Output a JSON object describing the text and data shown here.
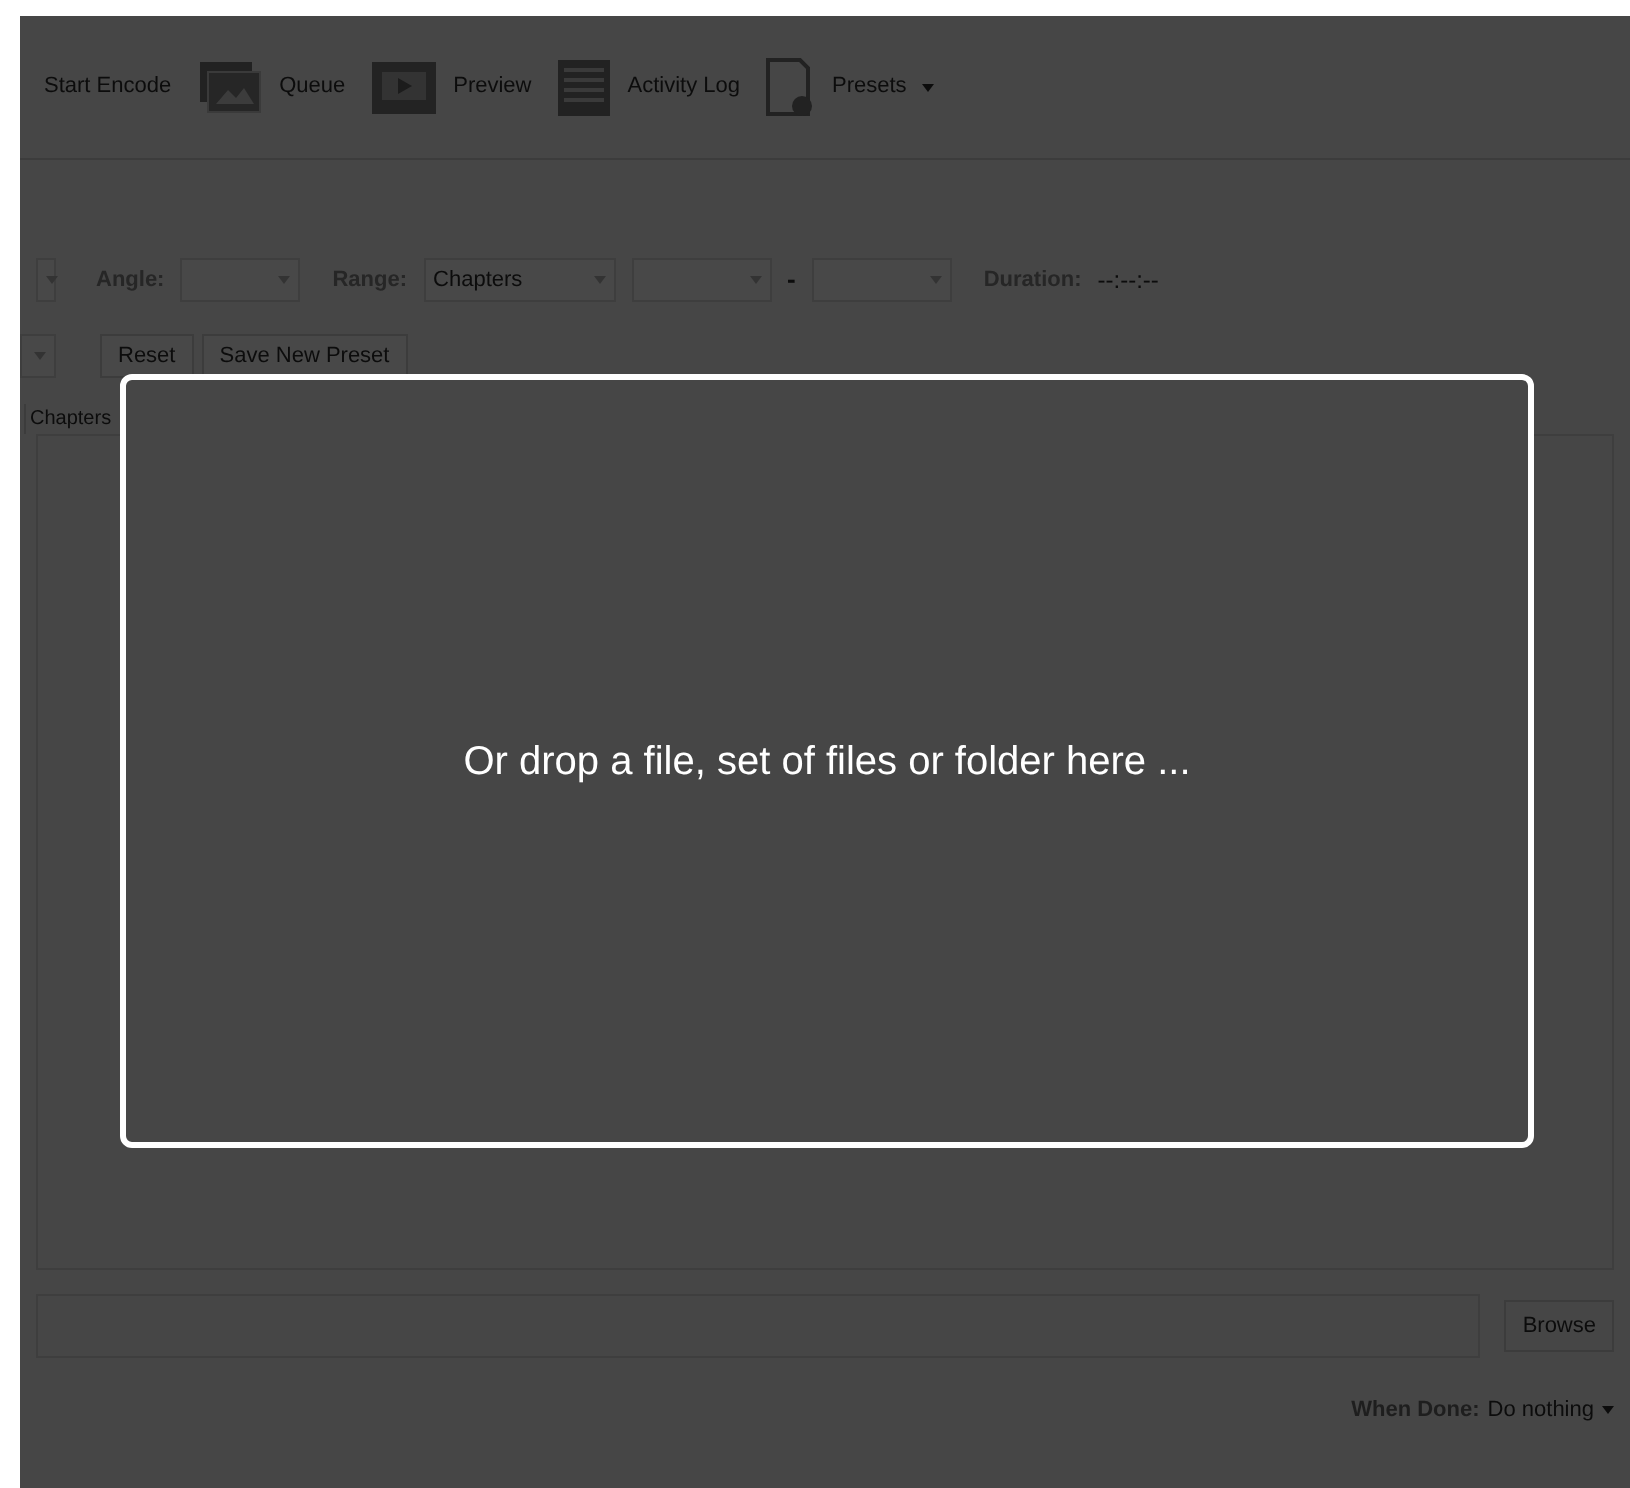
{
  "toolbar": [
    {
      "label": "Start Encode",
      "caret": false
    },
    {
      "label": "Queue",
      "caret": false
    },
    {
      "label": "Preview",
      "caret": false
    },
    {
      "label": "Activity Log",
      "caret": false
    },
    {
      "label": "Presets",
      "caret": true
    }
  ],
  "source_row": {
    "angle_label": "Angle:",
    "range_label": "Range:",
    "range_value": "Chapters",
    "separator": "-",
    "duration_label": "Duration:",
    "duration_value": "--:--:--"
  },
  "preset_buttons": [
    "Reset",
    "Save New Preset"
  ],
  "tabs": [
    {
      "label": "Chapters",
      "selected": false
    }
  ],
  "destination": {
    "browse": "Browse"
  },
  "when_done": {
    "label": "When Done:",
    "value": "Do nothing"
  },
  "drop_overlay": {
    "message": "Or drop a file, set of files or folder here ..."
  }
}
